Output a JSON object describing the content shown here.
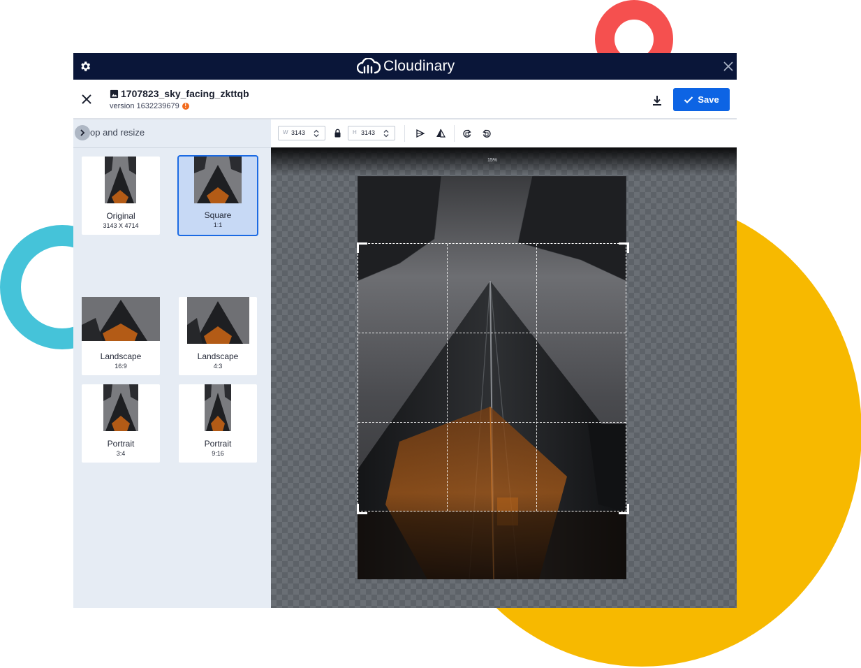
{
  "app": {
    "brand_name": "Cloudinary",
    "accent_color": "#0d64e4",
    "topbar_color": "#0a1639"
  },
  "header": {
    "file_name": "1707823_sky_facing_zkttqb",
    "version_text": "version 1632239679",
    "warning_badge": "!",
    "save_label": "Save"
  },
  "sidebar": {
    "title": "op and resize",
    "presets": [
      {
        "name": "Original",
        "dims": "3143 X 4714",
        "selected": false
      },
      {
        "name": "Square",
        "dims": "1:1",
        "selected": true
      },
      {
        "name": "Landscape",
        "dims": "16:9",
        "selected": false
      },
      {
        "name": "Landscape",
        "dims": "4:3",
        "selected": false
      },
      {
        "name": "Portrait",
        "dims": "3:4",
        "selected": false
      },
      {
        "name": "Portrait",
        "dims": "9:16",
        "selected": false
      }
    ]
  },
  "toolbar": {
    "width_label": "W",
    "width_value": "3143",
    "height_label": "H",
    "height_value": "3143",
    "icons": [
      "lock-icon",
      "flip-horizontal-icon",
      "flip-vertical-icon",
      "rotate-right-icon",
      "rotate-left-icon"
    ]
  },
  "canvas": {
    "zoom_text": "15%"
  }
}
